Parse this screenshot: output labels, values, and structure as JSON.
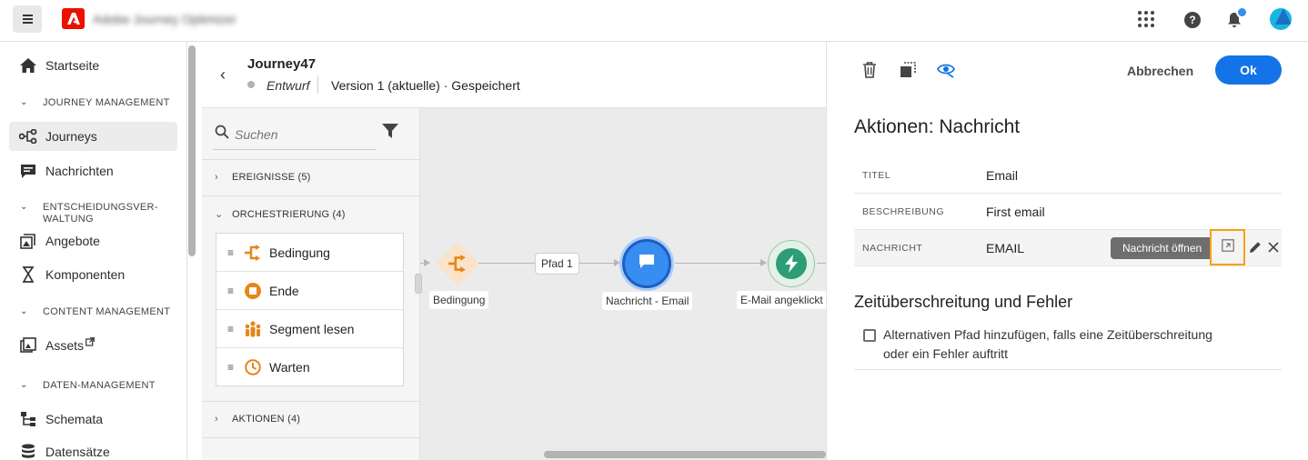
{
  "topbar": {
    "app_title": "Adobe Journey Optimizer",
    "icons": [
      "menu-icon",
      "adobe-logo",
      "apps-grid-icon",
      "help-icon",
      "notification-bell-icon",
      "user-avatar"
    ]
  },
  "sidebar": {
    "items": [
      {
        "label": "Startseite",
        "icon": "home-icon"
      },
      {
        "label": "Journeys",
        "icon": "journey-icon",
        "active": true
      },
      {
        "label": "Nachrichten",
        "icon": "message-icon"
      },
      {
        "label": "Angebote",
        "icon": "offers-icon"
      },
      {
        "label": "Komponenten",
        "icon": "components-icon"
      },
      {
        "label": "Assets",
        "icon": "assets-icon",
        "external": true
      },
      {
        "label": "Schemata",
        "icon": "schema-icon"
      },
      {
        "label": "Datensätze",
        "icon": "datasets-icon"
      }
    ],
    "sections": {
      "journey_mgmt": "JOURNEY MANAGEMENT",
      "decisioning_line1": "ENTSCHEIDUNGSVER-",
      "decisioning_line2": "WALTUNG",
      "content_mgmt": "CONTENT MANAGEMENT",
      "data_mgmt": "DATEN-MANAGEMENT"
    }
  },
  "journey": {
    "title": "Journey47",
    "status": "Entwurf",
    "version": "Version 1 (aktuelle) · Gespeichert"
  },
  "palette": {
    "search_placeholder": "Suchen",
    "categories": {
      "events": "EREIGNISSE (5)",
      "orchestration": "ORCHESTRIERUNG (4)",
      "actions": "AKTIONEN (4)"
    },
    "items": [
      {
        "label": "Bedingung",
        "icon": "condition-icon"
      },
      {
        "label": "Ende",
        "icon": "end-icon"
      },
      {
        "label": "Segment lesen",
        "icon": "segment-icon"
      },
      {
        "label": "Warten",
        "icon": "wait-icon"
      }
    ]
  },
  "canvas": {
    "path_label": "Pfad 1",
    "nodes": {
      "condition": "Bedingung",
      "message": "Nachricht - Email",
      "event": "E-Mail angeklickt"
    }
  },
  "panel": {
    "cancel_label": "Abbrechen",
    "ok_label": "Ok",
    "title": "Aktionen: Nachricht",
    "properties": [
      {
        "key": "TITEL",
        "value": "Email"
      },
      {
        "key": "BESCHREIBUNG",
        "value": "First email"
      },
      {
        "key": "NACHRICHT",
        "value": "EMAIL"
      }
    ],
    "tooltip": "Nachricht öffnen",
    "section_title": "Zeitüberschreitung und Fehler",
    "checkbox_line1": "Alternativen Pfad hinzufügen, falls eine Zeitüberschreitung",
    "checkbox_line2": "oder ein Fehler auftritt",
    "checkbox_checked": false
  },
  "colors": {
    "accent": "#1473e6",
    "highlight": "#f5a20c",
    "orchestration": "#e68619",
    "message_node": "#378ef0",
    "event_node": "#2d9d78"
  }
}
